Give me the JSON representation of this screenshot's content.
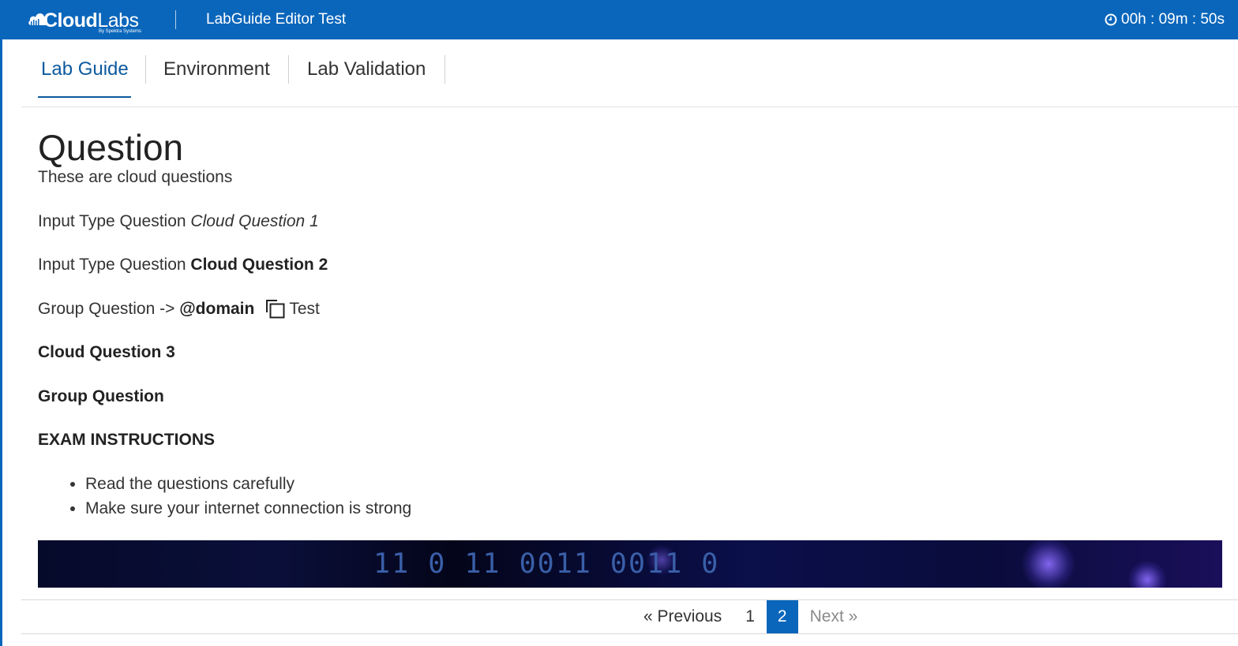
{
  "header": {
    "logo_bold": "Cloud",
    "logo_light": "Labs",
    "logo_sub": "By Spektra Systems",
    "title": "LabGuide Editor Test",
    "timer": "00h : 09m : 50s",
    "timer_icon": "clock-icon",
    "background_color": "#0a66bb"
  },
  "tabs": [
    {
      "label": "Lab Guide",
      "active": true
    },
    {
      "label": "Environment",
      "active": false
    },
    {
      "label": "Lab Validation",
      "active": false
    }
  ],
  "content": {
    "heading": "Question",
    "subtitle": "These are cloud questions",
    "q1_prefix": "Input Type Question ",
    "q1_name": "Cloud Question 1",
    "q2_prefix": "Input Type Question ",
    "q2_name": "Cloud Question 2",
    "group_prefix": "Group Question -> ",
    "group_value": "@domain",
    "group_after": "Test",
    "q3": "Cloud Question 3",
    "group_question": "Group Question",
    "instructions_heading": "EXAM INSTRUCTIONS",
    "instructions": [
      "Read the questions carefully",
      "Make sure your internet connection is strong"
    ],
    "banner_text": "11 0 11 0011 0011 0"
  },
  "pagination": {
    "previous": "« Previous",
    "pages": [
      "1",
      "2"
    ],
    "current": "2",
    "next": "Next »"
  },
  "colors": {
    "accent": "#0a66bb",
    "active_tab": "#0d5a9e"
  }
}
